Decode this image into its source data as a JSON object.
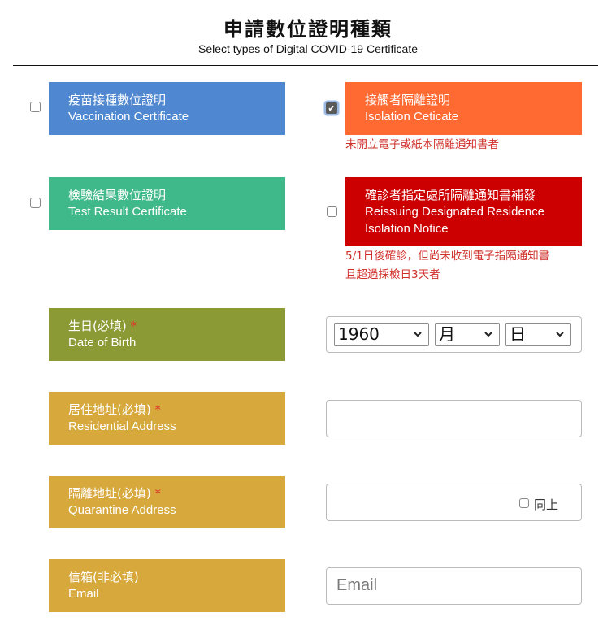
{
  "header": {
    "title": "申請數位證明種類",
    "subtitle": "Select types of Digital COVID-19 Certificate"
  },
  "certificates": {
    "vaccination": {
      "zh": "疫苗接種數位證明",
      "en": "Vaccination Certificate",
      "color": "#4f87d0",
      "checked": false
    },
    "isolation": {
      "zh": "接觸者隔離證明",
      "en": "Isolation Ceticate",
      "color": "#ff6a33",
      "checked": true,
      "note": "未開立電子或紙本隔離通知書者"
    },
    "test_result": {
      "zh": "檢驗結果數位證明",
      "en": "Test Result Certificate",
      "color": "#3fb98a",
      "checked": false
    },
    "reissue": {
      "zh": "確診者指定處所隔離通知書補發",
      "en_line1": "Reissuing Designated Residence",
      "en_line2": "Isolation Notice",
      "color": "#cc0000",
      "checked": false,
      "note_line1": "5/1日後確診，但尚未收到電子指隔通知書",
      "note_line2": "且超過採檢日3天者"
    }
  },
  "form": {
    "dob": {
      "zh": "生日(必填)",
      "en": "Date of Birth",
      "required_mark": "*",
      "year": "1960",
      "month": "月",
      "day": "日"
    },
    "residential": {
      "zh": "居住地址(必填)",
      "en": "Residential Address",
      "required_mark": "*",
      "value": ""
    },
    "quarantine": {
      "zh": "隔離地址(必填)",
      "en": "Quarantine Address",
      "required_mark": "*",
      "same_label": "同上"
    },
    "email": {
      "zh": "信箱(非必填)",
      "en": "Email",
      "placeholder": "Email"
    }
  },
  "colors": {
    "dob_label": "#8c9a36",
    "address_label": "#d7a83b",
    "required": "#e0302a",
    "note": "#d0302a"
  }
}
